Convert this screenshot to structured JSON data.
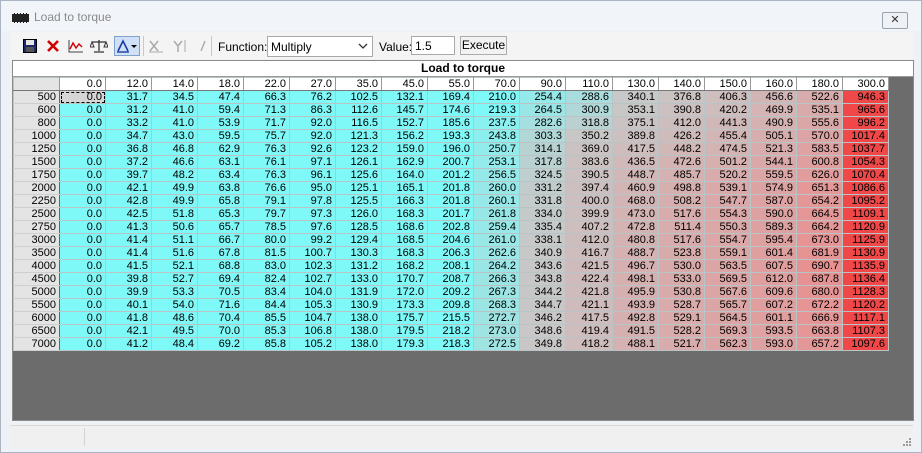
{
  "window": {
    "title": "Load to torque",
    "close_label": "✕"
  },
  "toolbar": {
    "icons": [
      "save-icon",
      "delete-icon",
      "graph-icon",
      "scale-icon",
      "interpolate-icon",
      "x-axis-icon",
      "y-axis-icon",
      "slash-icon"
    ],
    "function_label": "Function:",
    "function_value": "Multiply",
    "value_label": "Value:",
    "value": "1.5",
    "execute_label": "Execute"
  },
  "map": {
    "title": "Load to torque",
    "columns": [
      "0.0",
      "12.0",
      "14.0",
      "18.0",
      "22.0",
      "27.0",
      "35.0",
      "45.0",
      "55.0",
      "70.0",
      "90.0",
      "110.0",
      "130.0",
      "140.0",
      "150.0",
      "160.0",
      "180.0",
      "300.0"
    ],
    "rows": [
      {
        "rpm": "500",
        "values": [
          "0.0",
          "31.7",
          "34.5",
          "47.4",
          "66.3",
          "76.2",
          "102.5",
          "132.1",
          "169.4",
          "210.0",
          "254.4",
          "288.6",
          "340.1",
          "376.8",
          "406.3",
          "456.6",
          "522.6",
          "946.3"
        ]
      },
      {
        "rpm": "600",
        "values": [
          "0.0",
          "31.2",
          "41.0",
          "59.4",
          "71.3",
          "86.3",
          "112.6",
          "145.7",
          "174.6",
          "219.3",
          "264.5",
          "300.9",
          "353.1",
          "390.8",
          "420.2",
          "469.9",
          "535.1",
          "965.6"
        ]
      },
      {
        "rpm": "800",
        "values": [
          "0.0",
          "33.2",
          "41.0",
          "53.9",
          "71.7",
          "92.0",
          "116.5",
          "152.7",
          "185.6",
          "237.5",
          "282.6",
          "318.8",
          "375.1",
          "412.0",
          "441.3",
          "490.9",
          "555.6",
          "996.2"
        ]
      },
      {
        "rpm": "1000",
        "values": [
          "0.0",
          "34.7",
          "43.0",
          "59.5",
          "75.7",
          "92.0",
          "121.3",
          "156.2",
          "193.3",
          "243.8",
          "303.3",
          "350.2",
          "389.8",
          "426.2",
          "455.4",
          "505.1",
          "570.0",
          "1017.4"
        ]
      },
      {
        "rpm": "1250",
        "values": [
          "0.0",
          "36.8",
          "46.8",
          "62.9",
          "76.3",
          "92.6",
          "123.2",
          "159.0",
          "196.0",
          "250.7",
          "314.1",
          "369.0",
          "417.5",
          "448.2",
          "474.5",
          "521.3",
          "583.5",
          "1037.7"
        ]
      },
      {
        "rpm": "1500",
        "values": [
          "0.0",
          "37.2",
          "46.6",
          "63.1",
          "76.1",
          "97.1",
          "126.1",
          "162.9",
          "200.7",
          "253.1",
          "317.8",
          "383.6",
          "436.5",
          "472.6",
          "501.2",
          "544.1",
          "600.8",
          "1054.3"
        ]
      },
      {
        "rpm": "1750",
        "values": [
          "0.0",
          "39.7",
          "48.2",
          "63.4",
          "76.3",
          "96.1",
          "125.6",
          "164.0",
          "201.2",
          "256.5",
          "324.5",
          "390.5",
          "448.7",
          "485.7",
          "520.2",
          "559.5",
          "626.0",
          "1070.4"
        ]
      },
      {
        "rpm": "2000",
        "values": [
          "0.0",
          "42.1",
          "49.9",
          "63.8",
          "76.6",
          "95.0",
          "125.1",
          "165.1",
          "201.8",
          "260.0",
          "331.2",
          "397.4",
          "460.9",
          "498.8",
          "539.1",
          "574.9",
          "651.3",
          "1086.6"
        ]
      },
      {
        "rpm": "2250",
        "values": [
          "0.0",
          "42.8",
          "49.9",
          "65.8",
          "79.1",
          "97.8",
          "125.5",
          "166.3",
          "201.8",
          "260.1",
          "331.8",
          "400.0",
          "468.0",
          "508.2",
          "547.7",
          "587.0",
          "654.2",
          "1095.2"
        ]
      },
      {
        "rpm": "2500",
        "values": [
          "0.0",
          "42.5",
          "51.8",
          "65.3",
          "79.7",
          "97.3",
          "126.0",
          "168.3",
          "201.7",
          "261.8",
          "334.0",
          "399.9",
          "473.0",
          "517.6",
          "554.3",
          "590.0",
          "664.5",
          "1109.1"
        ]
      },
      {
        "rpm": "2750",
        "values": [
          "0.0",
          "41.3",
          "50.6",
          "65.7",
          "78.5",
          "97.6",
          "128.5",
          "168.6",
          "202.8",
          "259.4",
          "335.4",
          "407.2",
          "472.8",
          "511.4",
          "550.3",
          "589.3",
          "664.2",
          "1120.9"
        ]
      },
      {
        "rpm": "3000",
        "values": [
          "0.0",
          "41.4",
          "51.1",
          "66.7",
          "80.0",
          "99.2",
          "129.4",
          "168.5",
          "204.6",
          "261.0",
          "338.1",
          "412.0",
          "480.8",
          "517.6",
          "554.7",
          "595.4",
          "673.0",
          "1125.9"
        ]
      },
      {
        "rpm": "3500",
        "values": [
          "0.0",
          "41.4",
          "51.6",
          "67.8",
          "81.5",
          "100.7",
          "130.3",
          "168.3",
          "206.3",
          "262.6",
          "340.9",
          "416.7",
          "488.7",
          "523.8",
          "559.1",
          "601.4",
          "681.9",
          "1130.9"
        ]
      },
      {
        "rpm": "4000",
        "values": [
          "0.0",
          "41.5",
          "52.1",
          "68.8",
          "83.0",
          "102.3",
          "131.2",
          "168.2",
          "208.1",
          "264.2",
          "343.6",
          "421.5",
          "496.7",
          "530.0",
          "563.5",
          "607.5",
          "690.7",
          "1135.9"
        ]
      },
      {
        "rpm": "4500",
        "values": [
          "0.0",
          "39.8",
          "52.7",
          "69.4",
          "82.4",
          "102.7",
          "133.0",
          "170.7",
          "208.7",
          "266.3",
          "343.8",
          "422.4",
          "498.1",
          "533.0",
          "569.5",
          "612.0",
          "687.8",
          "1136.4"
        ]
      },
      {
        "rpm": "5000",
        "values": [
          "0.0",
          "39.9",
          "53.3",
          "70.5",
          "83.4",
          "104.0",
          "131.9",
          "172.0",
          "209.2",
          "267.3",
          "344.2",
          "421.8",
          "495.9",
          "530.8",
          "567.6",
          "609.6",
          "680.0",
          "1128.3"
        ]
      },
      {
        "rpm": "5500",
        "values": [
          "0.0",
          "40.1",
          "54.0",
          "71.6",
          "84.4",
          "105.3",
          "130.9",
          "173.3",
          "209.8",
          "268.3",
          "344.7",
          "421.1",
          "493.9",
          "528.7",
          "565.7",
          "607.2",
          "672.2",
          "1120.2"
        ]
      },
      {
        "rpm": "6000",
        "values": [
          "0.0",
          "41.8",
          "48.6",
          "70.4",
          "85.5",
          "104.7",
          "138.0",
          "175.7",
          "215.5",
          "272.7",
          "346.2",
          "417.5",
          "492.8",
          "529.1",
          "564.5",
          "601.1",
          "666.9",
          "1117.1"
        ]
      },
      {
        "rpm": "6500",
        "values": [
          "0.0",
          "42.1",
          "49.5",
          "70.0",
          "85.3",
          "106.8",
          "138.0",
          "179.5",
          "218.2",
          "273.0",
          "348.6",
          "419.4",
          "491.5",
          "528.2",
          "569.3",
          "593.5",
          "663.8",
          "1107.3"
        ]
      },
      {
        "rpm": "7000",
        "values": [
          "0.0",
          "41.2",
          "48.4",
          "69.2",
          "85.8",
          "105.2",
          "138.0",
          "179.3",
          "218.3",
          "272.5",
          "349.8",
          "418.2",
          "488.1",
          "521.7",
          "562.3",
          "593.0",
          "657.2",
          "1097.6"
        ]
      }
    ],
    "selected_cell": "500 / 0.0"
  },
  "colors": {
    "low": "#7ff8f8",
    "mid": "#c8c8c8",
    "high": "#e89090",
    "max": "#f04848"
  }
}
